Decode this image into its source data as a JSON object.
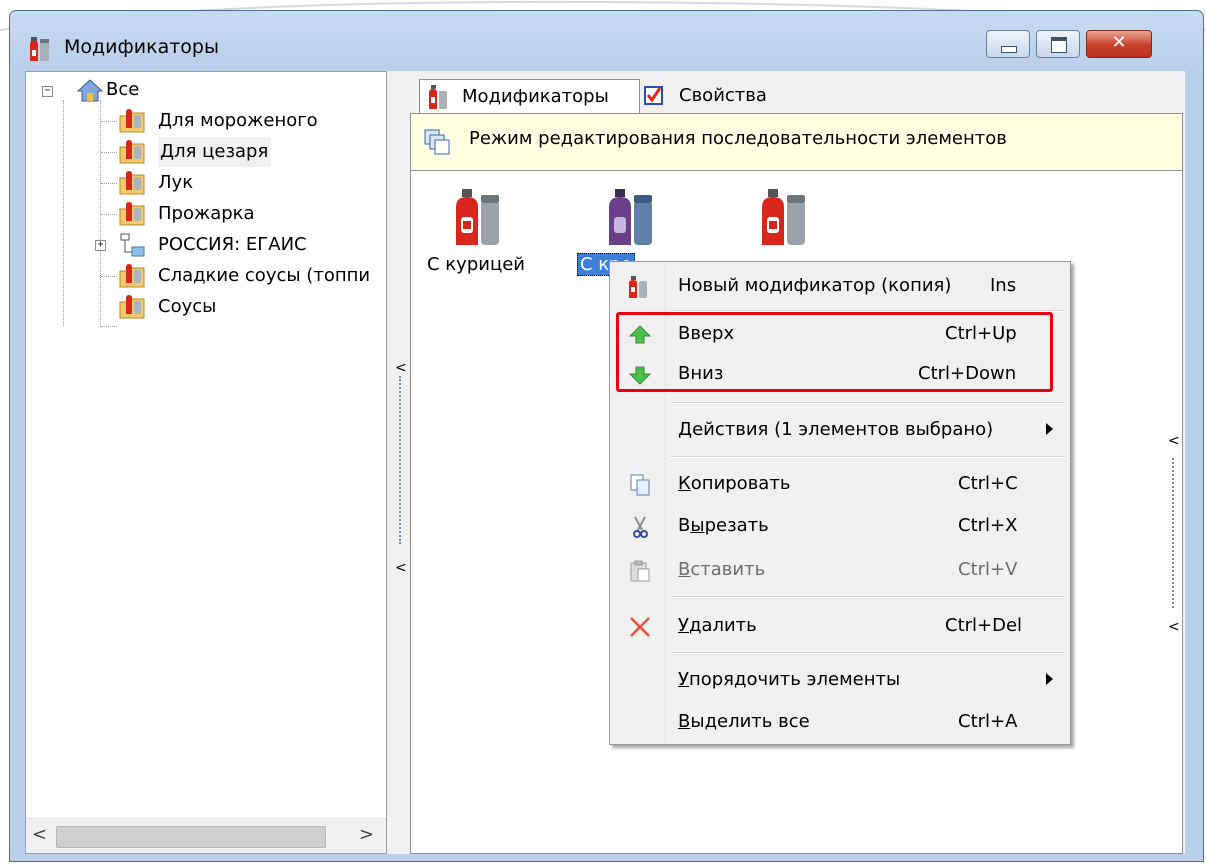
{
  "window": {
    "title": "Модификаторы",
    "close_glyph": "✕"
  },
  "tree": {
    "items": [
      {
        "label": "Все",
        "icon": "home-icon"
      },
      {
        "label": "Для мороженого",
        "icon": "folder-sauce-icon"
      },
      {
        "label": "Для цезаря",
        "icon": "folder-sauce-icon"
      },
      {
        "label": "Лук",
        "icon": "folder-sauce-icon"
      },
      {
        "label": "Прожарка",
        "icon": "folder-sauce-icon"
      },
      {
        "label": "РОССИЯ: ЕГАИС",
        "icon": "folder-tree-icon"
      },
      {
        "label": "Сладкие соусы (топпи",
        "icon": "folder-sauce-icon"
      },
      {
        "label": "Соусы",
        "icon": "folder-sauce-icon"
      }
    ],
    "expand_minus": "−",
    "expand_plus": "+",
    "scroll_left": "<",
    "scroll_right": ">"
  },
  "splitter": {
    "arrow": "<"
  },
  "tabs": [
    {
      "label": "Модификаторы",
      "active": true
    },
    {
      "label": "Свойства",
      "active": false
    }
  ],
  "infobar": {
    "text": "Режим редактирования последовательности элементов"
  },
  "items": [
    {
      "label": "С курицей",
      "selected": false,
      "color": "#d9261c"
    },
    {
      "label": "С кре",
      "selected": true,
      "color": "#6b3f8a"
    },
    {
      "label": "",
      "selected": false,
      "color": "#d9261c"
    }
  ],
  "context_menu": {
    "items": [
      {
        "id": "new",
        "pre": "",
        "u": "",
        "post": "Новый модификатор (копия)",
        "shortcut": "Ins",
        "icon": "sauce-icon"
      },
      {
        "id": "up",
        "pre": "",
        "u": "",
        "post": "Вверх",
        "shortcut": "Ctrl+Up",
        "icon": "arrow-up-icon"
      },
      {
        "id": "down",
        "pre": "",
        "u": "",
        "post": "Вниз",
        "shortcut": "Ctrl+Down",
        "icon": "arrow-down-icon"
      },
      {
        "id": "actions",
        "pre": "",
        "u": "",
        "post": "Действия (1 элементов выбрано)",
        "shortcut": "",
        "submenu": true
      },
      {
        "id": "copy",
        "pre": "",
        "u": "К",
        "post": "опировать",
        "shortcut": "Ctrl+C",
        "icon": "copy-icon"
      },
      {
        "id": "cut",
        "pre": "В",
        "u": "ы",
        "post": "резать",
        "shortcut": "Ctrl+X",
        "icon": "scissors-icon"
      },
      {
        "id": "paste",
        "pre": "",
        "u": "В",
        "post": "ставить",
        "shortcut": "Ctrl+V",
        "icon": "paste-icon",
        "disabled": true
      },
      {
        "id": "delete",
        "pre": "",
        "u": "У",
        "post": "далить",
        "shortcut": "Ctrl+Del",
        "icon": "delete-x-icon"
      },
      {
        "id": "arrange",
        "pre": "",
        "u": "У",
        "post": "порядочить элементы",
        "shortcut": "",
        "submenu": true
      },
      {
        "id": "selectall",
        "pre": "",
        "u": "В",
        "post": "ыделить все",
        "shortcut": "Ctrl+A"
      }
    ]
  },
  "colors": {
    "highlight": "#e8000f",
    "selection": "#3a7fd8",
    "infobar": "#ffffe1"
  }
}
